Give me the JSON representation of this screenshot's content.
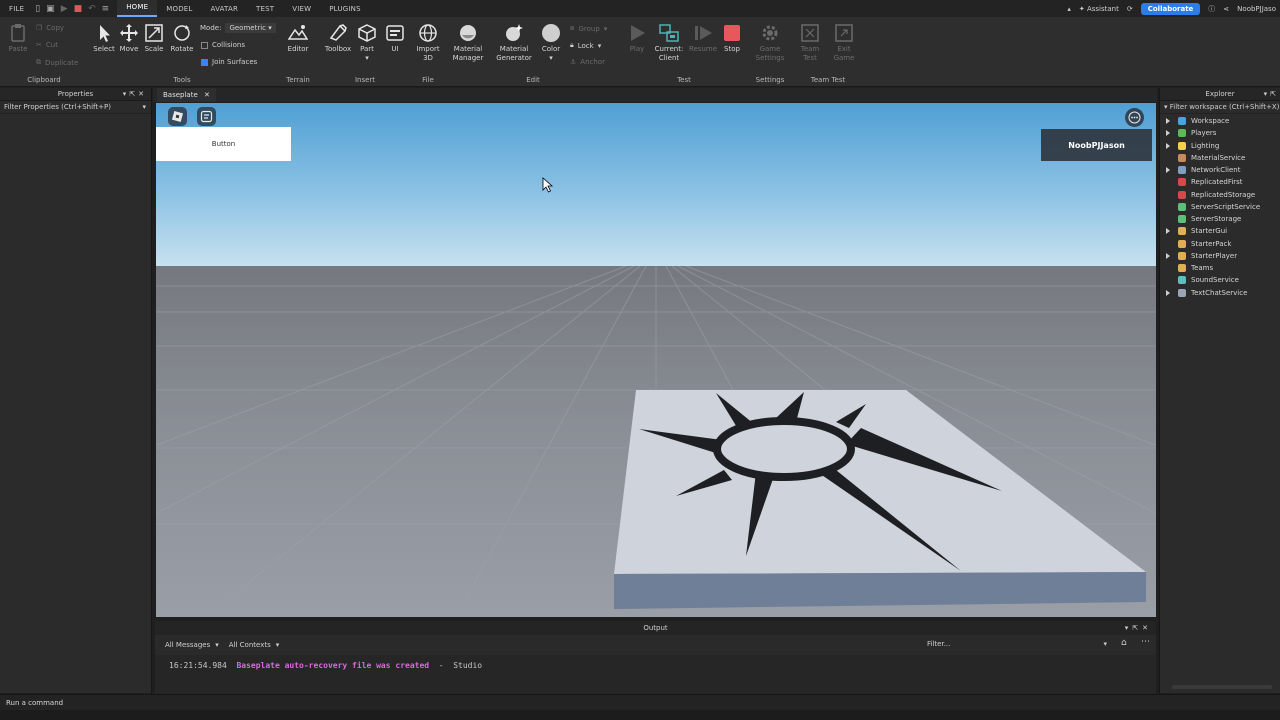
{
  "menu": {
    "file": "FILE",
    "tabs": [
      "HOME",
      "MODEL",
      "AVATAR",
      "TEST",
      "VIEW",
      "PLUGINS"
    ],
    "active_tab": "HOME",
    "assistant": "Assistant",
    "collaborate": "Collaborate",
    "user": "NoobPJJaso"
  },
  "ribbon": {
    "clipboard": {
      "label": "Clipboard",
      "paste": "Paste",
      "copy": "Copy",
      "cut": "Cut",
      "duplicate": "Duplicate"
    },
    "tools": {
      "label": "Tools",
      "select": "Select",
      "move": "Move",
      "scale": "Scale",
      "rotate": "Rotate",
      "mode_label": "Mode:",
      "mode_value": "Geometric",
      "collisions": "Collisions",
      "join_surfaces": "Join Surfaces"
    },
    "terrain": {
      "label": "Terrain",
      "editor": "Editor"
    },
    "insert": {
      "label": "Insert",
      "toolbox": "Toolbox",
      "part": "Part",
      "ui": "UI"
    },
    "file": {
      "label": "File",
      "import3d_line1": "Import",
      "import3d_line2": "3D"
    },
    "edit": {
      "label": "Edit",
      "material_manager_1": "Material",
      "material_manager_2": "Manager",
      "material_generator_1": "Material",
      "material_generator_2": "Generator",
      "color": "Color",
      "group": "Group",
      "lock": "Lock",
      "anchor": "Anchor"
    },
    "test": {
      "label": "Test",
      "play": "Play",
      "current_client_1": "Current:",
      "current_client_2": "Client",
      "resume": "Resume",
      "stop": "Stop"
    },
    "settings": {
      "label": "Settings",
      "game_settings_1": "Game",
      "game_settings_2": "Settings"
    },
    "team_test": {
      "label": "Team Test",
      "team_test_1": "Team",
      "team_test_2": "Test",
      "exit_game_1": "Exit",
      "exit_game_2": "Game"
    }
  },
  "properties": {
    "title": "Properties",
    "filter": "Filter Properties (Ctrl+Shift+P)"
  },
  "document": {
    "tab": "Baseplate"
  },
  "viewport": {
    "button_label": "Button",
    "player_name": "NoobPJJason"
  },
  "output": {
    "title": "Output",
    "messages_filter": "All Messages",
    "contexts_filter": "All Contexts",
    "filter_placeholder": "Filter...",
    "log": {
      "time": "16:21:54.984",
      "message": "Baseplate auto-recovery file was created",
      "sep": "-",
      "source": "Studio"
    }
  },
  "explorer": {
    "title": "Explorer",
    "filter": "Filter workspace (Ctrl+Shift+X)",
    "items": [
      {
        "label": "Workspace",
        "expandable": true,
        "color": "#4aa3e0"
      },
      {
        "label": "Players",
        "expandable": true,
        "color": "#5bb85b"
      },
      {
        "label": "Lighting",
        "expandable": true,
        "color": "#f0d24a"
      },
      {
        "label": "MaterialService",
        "expandable": false,
        "color": "#c98b5b"
      },
      {
        "label": "NetworkClient",
        "expandable": true,
        "color": "#7fa0c0"
      },
      {
        "label": "ReplicatedFirst",
        "expandable": false,
        "color": "#d44a4a"
      },
      {
        "label": "ReplicatedStorage",
        "expandable": false,
        "color": "#d44a4a"
      },
      {
        "label": "ServerScriptService",
        "expandable": false,
        "color": "#5cc07a"
      },
      {
        "label": "ServerStorage",
        "expandable": false,
        "color": "#5cc07a"
      },
      {
        "label": "StarterGui",
        "expandable": true,
        "color": "#e0b050"
      },
      {
        "label": "StarterPack",
        "expandable": false,
        "color": "#e0b050"
      },
      {
        "label": "StarterPlayer",
        "expandable": true,
        "color": "#e0b050"
      },
      {
        "label": "Teams",
        "expandable": false,
        "color": "#e0b050"
      },
      {
        "label": "SoundService",
        "expandable": false,
        "color": "#5cc0c0"
      },
      {
        "label": "TextChatService",
        "expandable": true,
        "color": "#9aa6b4"
      }
    ]
  },
  "command": {
    "placeholder": "Run a command"
  }
}
